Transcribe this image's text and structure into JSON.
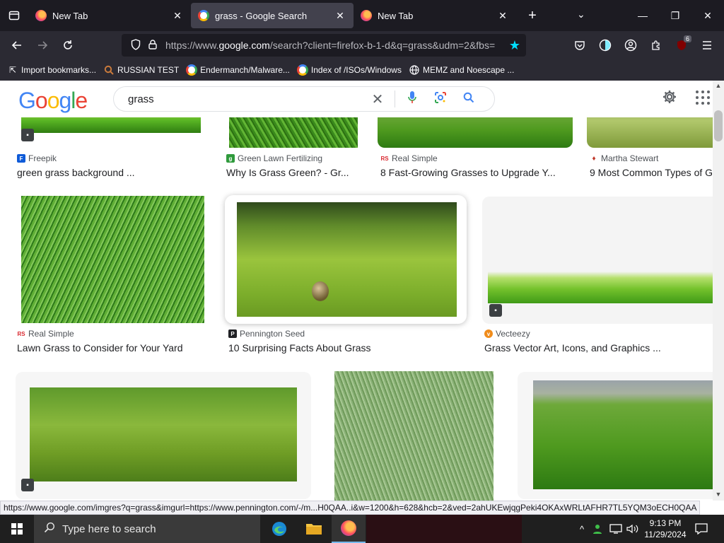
{
  "browser": {
    "tabs": [
      {
        "title": "New Tab",
        "favicon": "firefox-icon"
      },
      {
        "title": "grass - Google Search",
        "favicon": "google-icon",
        "active": true
      },
      {
        "title": "New Tab",
        "favicon": "firefox-icon"
      }
    ],
    "url_prefix": "https://www.",
    "url_domain": "google.com",
    "url_rest": "/search?client=firefox-b-1-d&q=grass&udm=2&fbs=",
    "extension_badge": "6",
    "bookmarks": [
      {
        "label": "Import bookmarks...",
        "icon": "import-icon"
      },
      {
        "label": "RUSSIAN TEST",
        "icon": "search-icon"
      },
      {
        "label": "Endermanch/Malware...",
        "icon": "google-icon"
      },
      {
        "label": "Index of /ISOs/Windows",
        "icon": "google-icon"
      },
      {
        "label": "MEMZ and Noescape ...",
        "icon": "globe-icon"
      }
    ]
  },
  "google": {
    "logo": "Google",
    "query": "grass"
  },
  "results": [
    {
      "source": "Freepik",
      "caption": "green grass background ..."
    },
    {
      "source": "Green Lawn Fertilizing",
      "caption": "Why Is Grass Green? - Gr..."
    },
    {
      "source": "Real Simple",
      "caption": "8 Fast-Growing Grasses to Upgrade Y..."
    },
    {
      "source": "Martha Stewart",
      "caption": "9 Most Common Types of G"
    },
    {
      "source": "Real Simple",
      "caption": "Lawn Grass to Consider for Your Yard"
    },
    {
      "source": "Pennington Seed",
      "caption": "10 Surprising Facts About Grass"
    },
    {
      "source": "Vecteezy",
      "caption": "Grass Vector Art, Icons, and Graphics ..."
    }
  ],
  "status_url": "https://www.google.com/imgres?q=grass&imgurl=https://www.pennington.com/-/m...H0QAA..i&w=1200&h=628&hcb=2&ved=2ahUKEwjqgPeki4OKAxWRLtAFHR7TL5YQM3oECH0QAA",
  "taskbar": {
    "search_placeholder": "Type here to search",
    "time": "9:13 PM",
    "date": "11/29/2024"
  },
  "colors": {
    "google_blue": "#4285f4",
    "google_red": "#ea4335",
    "google_yellow": "#fbbc05",
    "google_green": "#34a853",
    "firefox_star": "#00ddff"
  }
}
